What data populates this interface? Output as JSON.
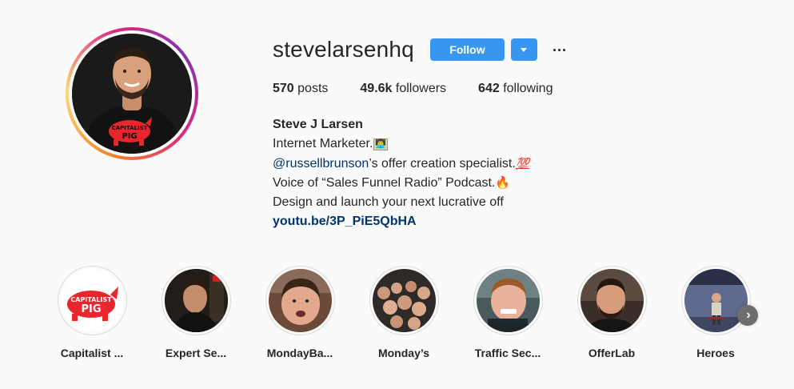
{
  "profile": {
    "username": "stevelarsenhq",
    "follow_label": "Follow",
    "dropdown_icon": "chevron-down-icon",
    "more_icon": "more-options-icon",
    "shirt_text_top": "CAPITALIST",
    "shirt_text_bottom": "PIG"
  },
  "stats": {
    "posts_count": "570",
    "posts_label": "posts",
    "followers_count": "49.6k",
    "followers_label": "followers",
    "following_count": "642",
    "following_label": "following"
  },
  "bio": {
    "full_name": "Steve J Larsen",
    "line1": "Internet Marketer.",
    "line1_emoji": "👨‍💻",
    "mention": "@russellbrunson",
    "line2_rest": "’s offer creation specialist.",
    "line2_emoji": "💯",
    "line3": "Voice of “Sales Funnel Radio” Podcast.",
    "line3_emoji": "🔥",
    "line4": "Design and launch your next lucrative off",
    "link": "youtu.be/3P_PiE5QbHA"
  },
  "highlights": [
    {
      "label": "Capitalist ..."
    },
    {
      "label": "Expert Se..."
    },
    {
      "label": "MondayBa..."
    },
    {
      "label": "Monday’s"
    },
    {
      "label": "Traffic Sec..."
    },
    {
      "label": "OfferLab"
    },
    {
      "label": "Heroes"
    }
  ],
  "next_icon": "chevron-right-icon",
  "colors": {
    "accent": "#3897f0",
    "link": "#003569",
    "background": "#fafafa",
    "pig_red": "#e8262c"
  }
}
